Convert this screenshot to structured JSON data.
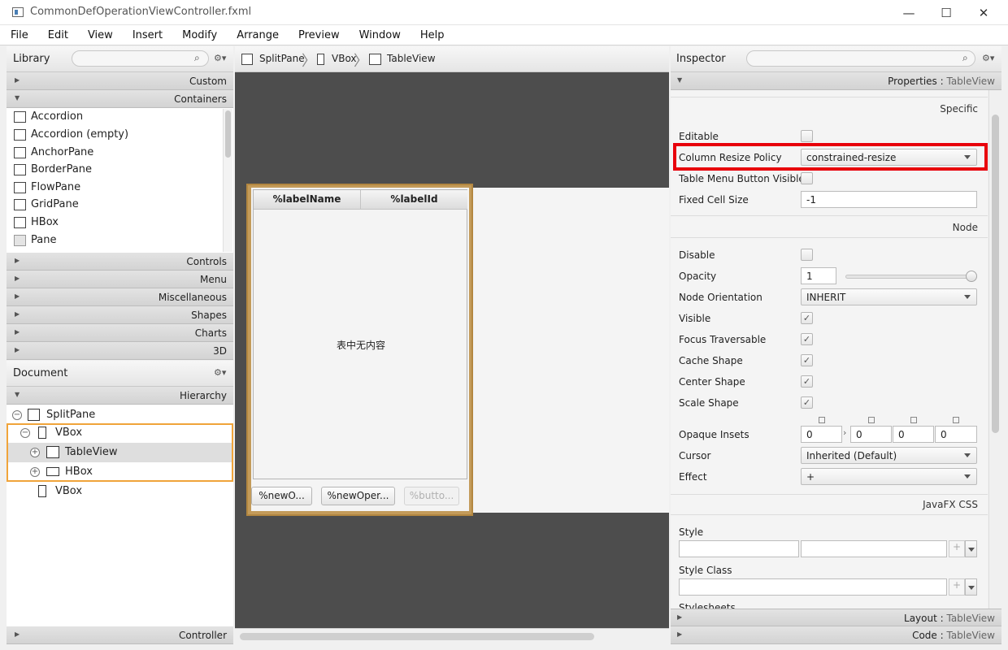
{
  "window": {
    "title": "CommonDefOperationViewController.fxml",
    "minimize": "—",
    "maximize": "☐",
    "close": "✕"
  },
  "menu": [
    "File",
    "Edit",
    "View",
    "Insert",
    "Modify",
    "Arrange",
    "Preview",
    "Window",
    "Help"
  ],
  "library": {
    "title": "Library",
    "sections_top": [
      {
        "label": "Custom",
        "arrow": "▶"
      },
      {
        "label": "Containers",
        "arrow": "▼"
      }
    ],
    "items": [
      "Accordion",
      "Accordion  (empty)",
      "AnchorPane",
      "BorderPane",
      "FlowPane",
      "GridPane",
      "HBox",
      "Pane"
    ],
    "sections_bottom": [
      "Controls",
      "Menu",
      "Miscellaneous",
      "Shapes",
      "Charts",
      "3D"
    ]
  },
  "document": {
    "title": "Document",
    "hierarchy_label": "Hierarchy",
    "tree": [
      {
        "label": "SplitPane",
        "expander": "⊖"
      },
      {
        "label": "VBox",
        "expander": "⊖"
      },
      {
        "label": "TableView",
        "expander": "⊕"
      },
      {
        "label": "HBox",
        "expander": "⊕"
      },
      {
        "label": "VBox",
        "expander": ""
      }
    ],
    "controller_label": "Controller"
  },
  "breadcrumb": [
    "SplitPane",
    "VBox",
    "TableView"
  ],
  "canvas": {
    "columns": [
      "%labelName",
      "%labelId"
    ],
    "empty_text": "表中无内容",
    "buttons": [
      "%newO...",
      "%newOper...",
      "%butto..."
    ]
  },
  "inspector": {
    "title": "Inspector",
    "properties_header": "Properties",
    "properties_target": "TableView",
    "specific_label": "Specific",
    "node_label": "Node",
    "javafx_css_label": "JavaFX CSS",
    "props": {
      "editable": "Editable",
      "column_resize_policy": "Column Resize Policy",
      "column_resize_value": "constrained-resize",
      "table_menu_button_visible": "Table Menu Button Visible",
      "fixed_cell_size": "Fixed Cell Size",
      "fixed_cell_size_value": "-1",
      "disable": "Disable",
      "opacity": "Opacity",
      "opacity_value": "1",
      "node_orientation": "Node Orientation",
      "node_orientation_value": "INHERIT",
      "visible": "Visible",
      "focus_traversable": "Focus Traversable",
      "cache_shape": "Cache Shape",
      "center_shape": "Center Shape",
      "scale_shape": "Scale Shape",
      "opaque_insets": "Opaque Insets",
      "opaque_insets_values": [
        "0",
        "0",
        "0",
        "0"
      ],
      "cursor": "Cursor",
      "cursor_value": "Inherited (Default)",
      "effect": "Effect",
      "effect_value": "+",
      "style": "Style",
      "style_class": "Style Class",
      "stylesheets": "Stylesheets"
    },
    "footer": [
      {
        "label": "Layout",
        "target": "TableView"
      },
      {
        "label": "Code",
        "target": "TableView"
      }
    ]
  },
  "colors": {
    "highlight_red": "#e8000b",
    "selection_orange": "#f0a43a",
    "canvas_dark": "#4d4d4d",
    "table_frame": "#b38740"
  }
}
